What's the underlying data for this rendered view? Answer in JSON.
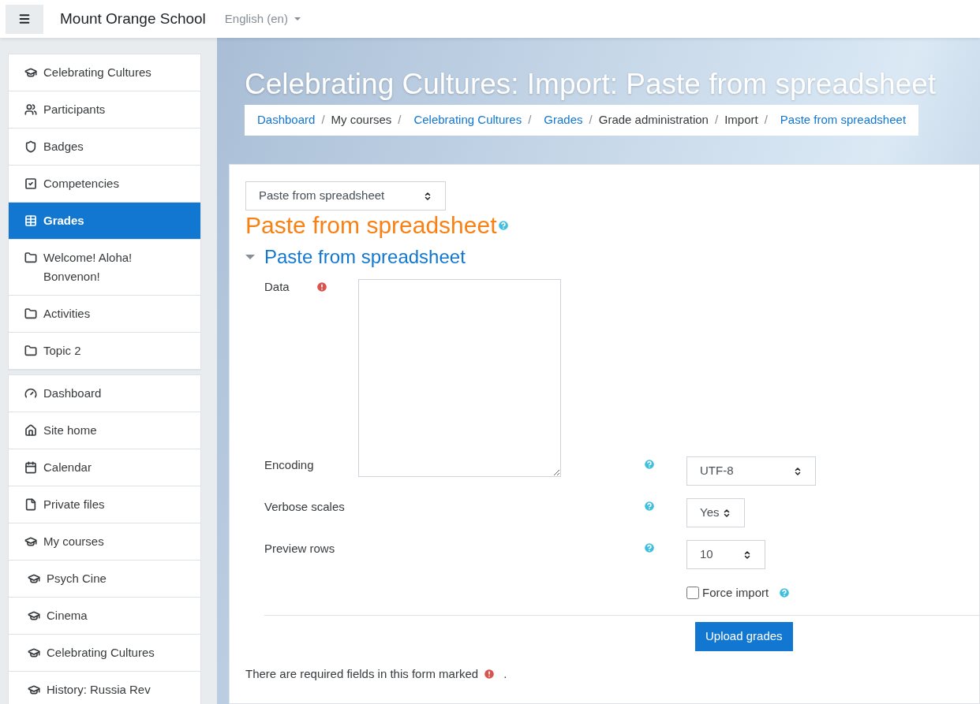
{
  "navbar": {
    "brand": "Mount Orange School",
    "language": "English (en)"
  },
  "sidebar": {
    "groups": [
      {
        "items": [
          {
            "kind": "course",
            "label": "Celebrating Cultures",
            "selected": false
          },
          {
            "kind": "users",
            "label": "Participants",
            "selected": false
          },
          {
            "kind": "badge",
            "label": "Badges",
            "selected": false
          },
          {
            "kind": "check",
            "label": "Competencies",
            "selected": false
          },
          {
            "kind": "table",
            "label": "Grades",
            "selected": true
          },
          {
            "kind": "folder",
            "label": "Welcome! Aloha! Bonvenon!",
            "selected": false
          },
          {
            "kind": "folder",
            "label": "Activities",
            "selected": false
          },
          {
            "kind": "folder",
            "label": "Topic 2",
            "selected": false
          }
        ]
      },
      {
        "items": [
          {
            "kind": "dashboard",
            "label": "Dashboard",
            "selected": false
          },
          {
            "kind": "home",
            "label": "Site home",
            "selected": false
          },
          {
            "kind": "calendar",
            "label": "Calendar",
            "selected": false
          },
          {
            "kind": "file",
            "label": "Private files",
            "selected": false
          },
          {
            "kind": "course",
            "label": "My courses",
            "selected": false,
            "children": [
              {
                "kind": "course",
                "label": "Psych Cine",
                "selected": false
              },
              {
                "kind": "course",
                "label": "Cinema",
                "selected": false
              },
              {
                "kind": "course",
                "label": "Celebrating Cultures",
                "selected": false
              },
              {
                "kind": "course",
                "label": "History: Russia Rev",
                "selected": false
              }
            ]
          }
        ]
      }
    ]
  },
  "header": {
    "title": "Celebrating Cultures: Import: Paste from spreadsheet",
    "breadcrumb": [
      {
        "kind": "link",
        "label": "Dashboard"
      },
      {
        "kind": "separator",
        "label": "/"
      },
      {
        "kind": "text",
        "label": "My courses"
      },
      {
        "kind": "separator",
        "label": "/"
      },
      {
        "kind": "link",
        "label": "Celebrating Cultures"
      },
      {
        "kind": "separator",
        "label": "/"
      },
      {
        "kind": "link",
        "label": "Grades"
      },
      {
        "kind": "separator",
        "label": "/"
      },
      {
        "kind": "text",
        "label": "Grade administration"
      },
      {
        "kind": "separator",
        "label": "/"
      },
      {
        "kind": "text",
        "label": "Import"
      },
      {
        "kind": "separator",
        "label": "/"
      },
      {
        "kind": "link",
        "label": "Paste from spreadsheet"
      }
    ]
  },
  "content": {
    "import_select": "Paste from spreadsheet",
    "heading": "Paste from spreadsheet",
    "section": {
      "title": "Paste from spreadsheet",
      "expanded": true
    },
    "data_field": {
      "label": "Data",
      "required": true
    },
    "selects": [
      {
        "label": "Encoding",
        "value": "UTF-8"
      },
      {
        "label": "Verbose scales",
        "value": "Yes"
      },
      {
        "label": "Preview rows",
        "value": "10"
      }
    ],
    "force_import": {
      "label": "Force import",
      "checked": false
    },
    "submit": "Upload grades",
    "required_note": "There are required fields in this form marked",
    "required_note_end": "."
  }
}
